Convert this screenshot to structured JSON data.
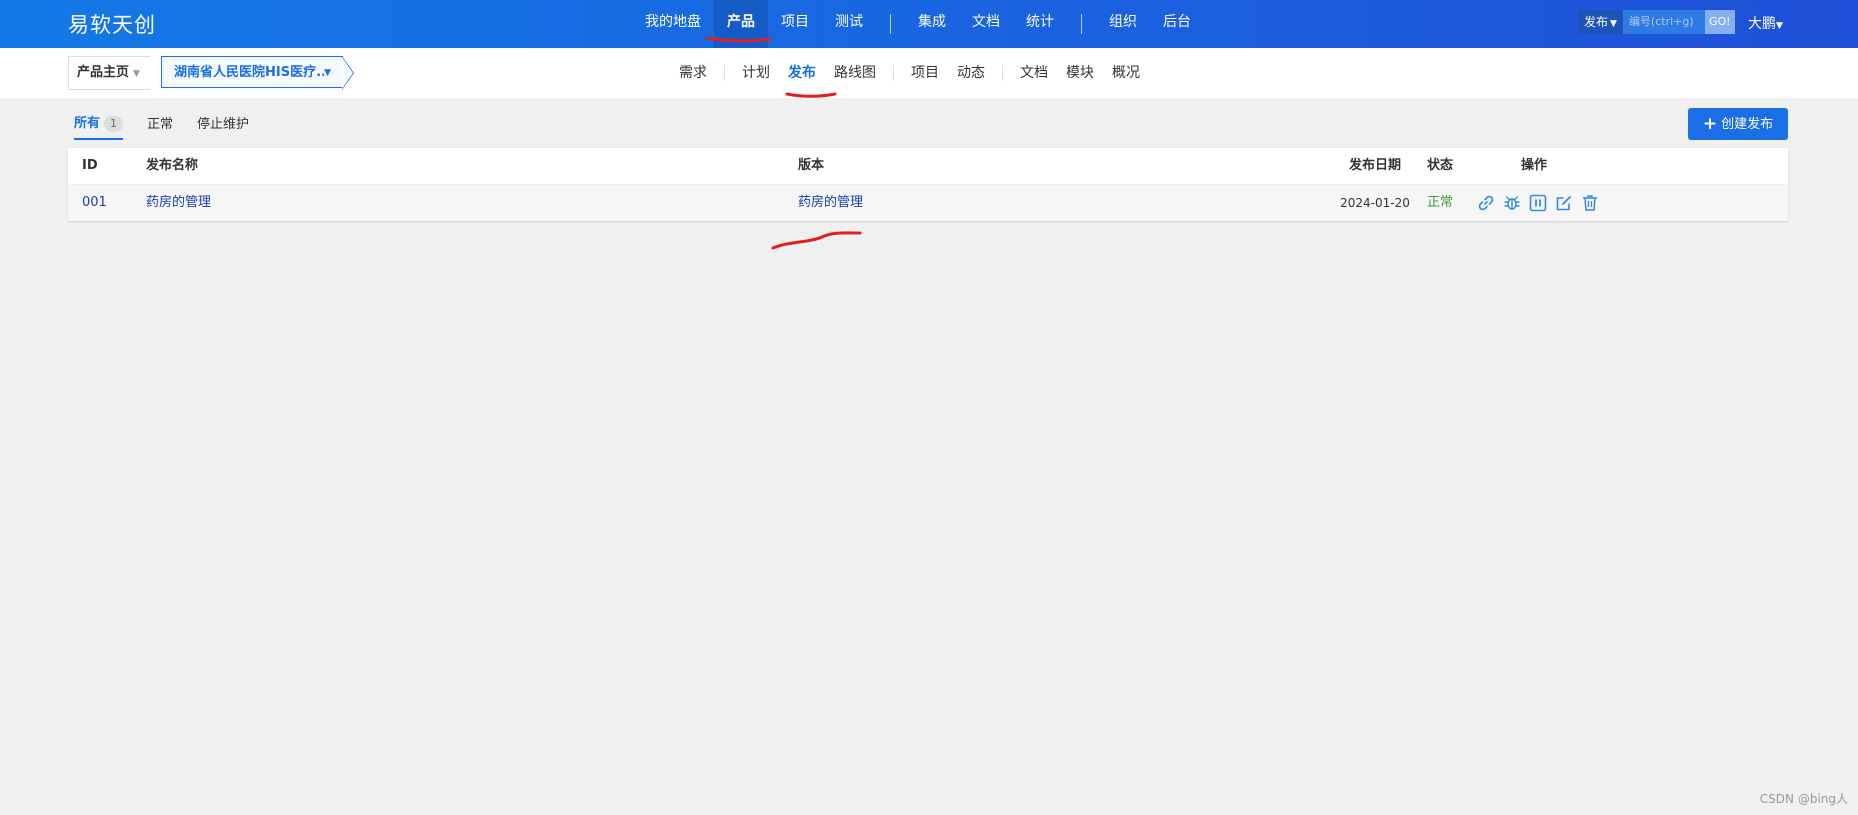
{
  "app": {
    "brand": "易软天创"
  },
  "main_nav": {
    "items": [
      {
        "label": "我的地盘"
      },
      {
        "label": "产品"
      },
      {
        "label": "项目"
      },
      {
        "label": "测试"
      },
      {
        "label": "集成"
      },
      {
        "label": "文档"
      },
      {
        "label": "统计"
      },
      {
        "label": "组织"
      },
      {
        "label": "后台"
      }
    ],
    "active": "产品"
  },
  "search": {
    "type_label": "发布",
    "placeholder": "编号(ctrl+g)",
    "go_label": "GO!"
  },
  "user": {
    "name": "大鹏"
  },
  "breadcrumb": {
    "home": "产品主页",
    "product": "湖南省人民医院HIS医疗..."
  },
  "sub_nav": {
    "items": [
      {
        "label": "需求"
      },
      {
        "label": "计划"
      },
      {
        "label": "发布"
      },
      {
        "label": "路线图"
      },
      {
        "label": "项目"
      },
      {
        "label": "动态"
      },
      {
        "label": "文档"
      },
      {
        "label": "模块"
      },
      {
        "label": "概况"
      }
    ],
    "active": "发布"
  },
  "filters": {
    "all_label": "所有",
    "all_count": "1",
    "normal_label": "正常",
    "stopped_label": "停止维护"
  },
  "create_button": {
    "label": "创建发布"
  },
  "table": {
    "headers": {
      "id": "ID",
      "name": "发布名称",
      "version": "版本",
      "date": "发布日期",
      "status": "状态",
      "actions": "操作"
    },
    "rows": [
      {
        "id": "001",
        "name": "药房的管理",
        "version": "药房的管理",
        "date": "2024-01-20",
        "status": "正常"
      }
    ]
  },
  "row_action_icons": [
    "link-icon",
    "bug-icon",
    "pause-icon",
    "edit-icon",
    "delete-icon"
  ],
  "colors": {
    "accent": "#1a6ee6",
    "status_normal": "#3a9d3a",
    "annotation": "#e02020"
  },
  "watermark": "CSDN @bing人"
}
